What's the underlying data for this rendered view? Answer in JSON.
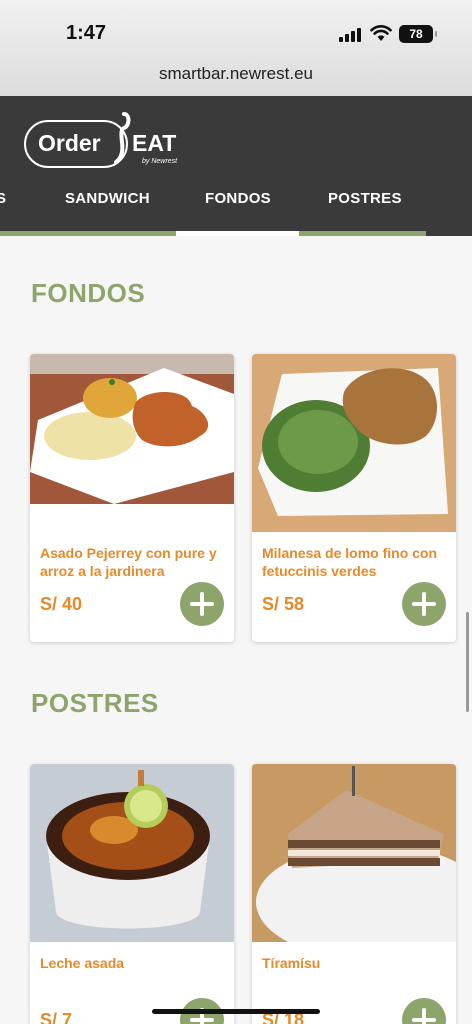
{
  "status_bar": {
    "time": "1:47",
    "battery": "78"
  },
  "browser": {
    "url": "smartbar.newrest.eu"
  },
  "app": {
    "logo": {
      "order": "Order",
      "eat": "EAT",
      "by": "by Newrest"
    },
    "tabs": [
      {
        "label": "S"
      },
      {
        "label": "SANDWICH"
      },
      {
        "label": "FONDOS"
      },
      {
        "label": "POSTRES"
      }
    ],
    "active_tab": "FONDOS"
  },
  "sections": [
    {
      "title": "FONDOS",
      "items": [
        {
          "name": "Asado Pejerrey con pure y arroz a la jardinera",
          "price": "S/ 40"
        },
        {
          "name": "Milanesa de lomo fino con fetuccinis verdes",
          "price": "S/ 58"
        }
      ]
    },
    {
      "title": "POSTRES",
      "items": [
        {
          "name": "Leche asada",
          "price": "S/ 7"
        },
        {
          "name": "Tíramísu",
          "price": "S/ 18"
        }
      ]
    }
  ],
  "colors": {
    "accent_green": "#8da56b",
    "price_orange": "#e58a2b",
    "header_dark": "#3a3a3a"
  }
}
